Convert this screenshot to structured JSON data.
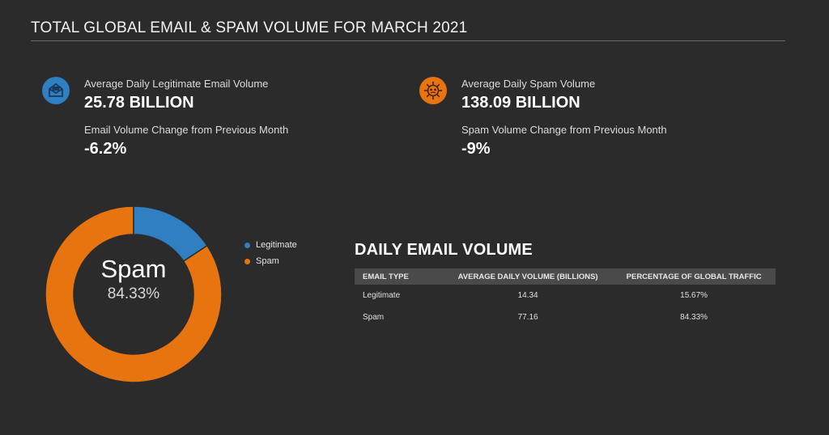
{
  "header": {
    "title": "TOTAL GLOBAL EMAIL & SPAM VOLUME FOR MARCH 2021"
  },
  "stats": {
    "legit": {
      "icon": "envelope-icon",
      "color": "#2f7fc1",
      "volume_label": "Average Daily Legitimate Email Volume",
      "volume_value": "25.78 BILLION",
      "change_label": "Email Volume Change from Previous Month",
      "change_value": "-6.2%"
    },
    "spam": {
      "icon": "virus-icon",
      "color": "#e8740f",
      "volume_label": "Average Daily Spam Volume",
      "volume_value": "138.09 BILLION",
      "change_label": "Spam Volume Change from Previous Month",
      "change_value": "-9%"
    }
  },
  "chart_data": {
    "type": "pie",
    "subtype": "donut",
    "categories": [
      "Legitimate",
      "Spam"
    ],
    "values": [
      15.67,
      84.33
    ],
    "colors": [
      "#2f7fc1",
      "#e8740f"
    ],
    "center_label": "Spam",
    "center_value": "84.33%",
    "legend": {
      "position": "top-right",
      "entries": [
        "Legitimate",
        "Spam"
      ]
    }
  },
  "table": {
    "title": "DAILY EMAIL VOLUME",
    "headers": [
      "EMAIL TYPE",
      "AVERAGE DAILY VOLUME (BILLIONS)",
      "PERCENTAGE OF GLOBAL TRAFFIC"
    ],
    "rows": [
      [
        "Legitimate",
        "14.34",
        "15.67%"
      ],
      [
        "Spam",
        "77.16",
        "84.33%"
      ]
    ]
  }
}
